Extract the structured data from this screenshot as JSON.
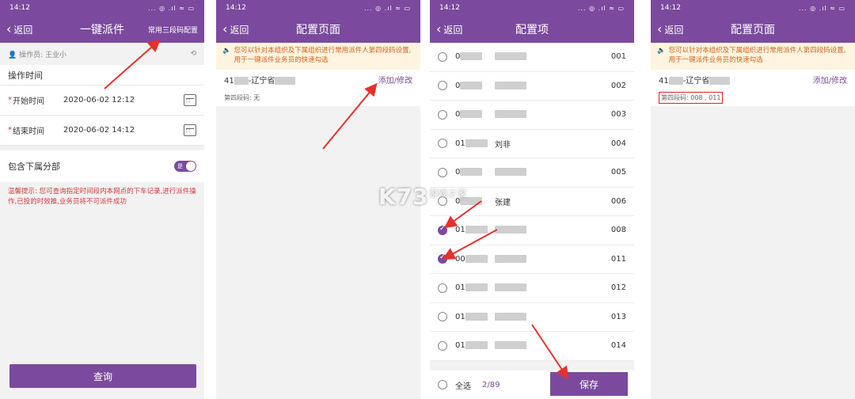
{
  "colors": {
    "brand": "#7b4a9e",
    "warning": "#d0641e",
    "tip": "#d23b3b",
    "arrow": "#e8302a"
  },
  "status": {
    "time": "14:12",
    "icons": "... ◎ .ıl ≈ ▭"
  },
  "panel1": {
    "back_label": "返回",
    "title": "一键派件",
    "header_right": "常用三段码配置",
    "operator": "操作员: 王业小",
    "section_title": "操作时间",
    "start_label": "开始时间",
    "start_value": "2020-06-02 12:12",
    "end_label": "结束时间",
    "end_value": "2020-06-02 14:12",
    "include_sub_label": "包含下属分部",
    "toggle_text": "是",
    "tip": "温馨提示: 您可查询指定时间段内本网点的下车记录,进行派件操作,已投的时效推,业务员将不可派件成功",
    "query_label": "查询"
  },
  "panel2": {
    "back_label": "返回",
    "title": "配置页面",
    "notice": "您可以针对本组织及下属组织进行常用派件人第四段码设置,用于一键派件业务员的快速勾选",
    "code_prefix": "41",
    "region": "-辽宁省",
    "edit_label": "添加/修改",
    "fourth_code": "第四段码: 无"
  },
  "panel3": {
    "back_label": "返回",
    "title": "配置项",
    "items": [
      {
        "id": "0",
        "name": "",
        "code": "001",
        "checked": false
      },
      {
        "id": "0",
        "name": "",
        "code": "002",
        "checked": false
      },
      {
        "id": "0",
        "name": "",
        "code": "003",
        "checked": false
      },
      {
        "id": "01",
        "name": "刘非",
        "code": "004",
        "checked": false
      },
      {
        "id": "0",
        "name": "",
        "code": "005",
        "checked": false
      },
      {
        "id": "0",
        "name": "张建",
        "code": "006",
        "checked": false
      },
      {
        "id": "01",
        "name": "",
        "code": "008",
        "checked": true
      },
      {
        "id": "00",
        "name": "",
        "code": "011",
        "checked": true
      },
      {
        "id": "01",
        "name": "",
        "code": "012",
        "checked": false
      },
      {
        "id": "01",
        "name": "",
        "code": "013",
        "checked": false
      },
      {
        "id": "01",
        "name": "",
        "code": "014",
        "checked": false
      }
    ],
    "select_all": "全选",
    "count": "2/89",
    "save_label": "保存"
  },
  "panel4": {
    "back_label": "返回",
    "title": "配置页面",
    "notice": "您可以针对本组织及下属组织进行常用派件人第四段码设置,用于一键派件业务员的快速勾选",
    "code_prefix": "41",
    "region": "-辽宁省",
    "edit_label": "添加/修改",
    "fourth_code": "第四段码: 008 , 011"
  },
  "watermark": {
    "logo": "K73",
    "text": "游戏之家"
  }
}
